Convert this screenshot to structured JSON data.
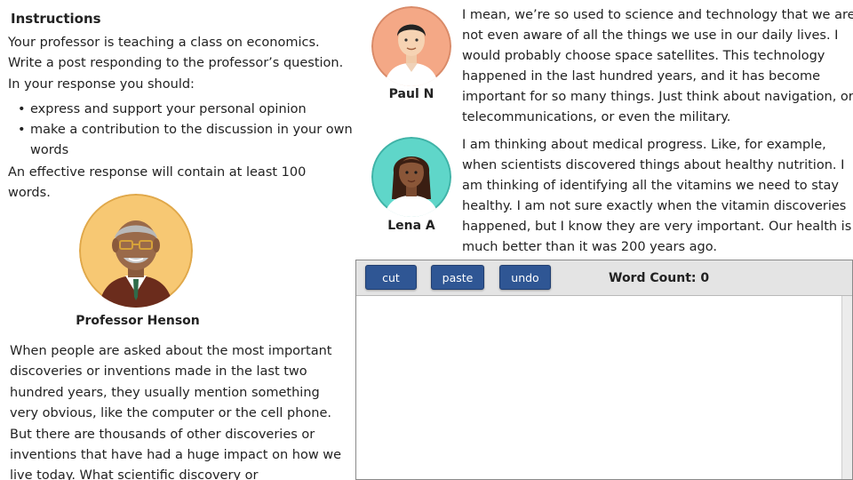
{
  "instructions": {
    "title": "Instructions",
    "lines": [
      "Your professor is teaching a class on economics.",
      "Write a post responding to the professor’s question.",
      "In your response you should:"
    ],
    "bullets": [
      "express and support your personal opinion",
      "make a contribution to the discussion in your own",
      "words"
    ],
    "effective": [
      "An effective response will contain at least 100",
      "words."
    ]
  },
  "professor": {
    "name": "Professor Henson",
    "text_lines": [
      "When people are asked about the most important",
      "discoveries or inventions made in the last two",
      "hundred years, they usually mention something",
      "very obvious, like the computer or the cell phone.",
      "But there are thousands of other discoveries or",
      "inventions that have had a huge impact on how we",
      "live today. What scientific discovery or"
    ]
  },
  "students": [
    {
      "name": "Paul N",
      "text_lines": [
        "I mean, we’re so used to science and technology that we are",
        "not even aware of all the things we use in our daily lives. I",
        "would probably choose space satellites. This technology",
        "happened in the last hundred years, and it has become",
        "important for so many things. Just think about navigation, or",
        "telecommunications, or even the military."
      ]
    },
    {
      "name": "Lena A",
      "text_lines": [
        "I am thinking about medical progress. Like, for example,",
        "when scientists discovered things about healthy nutrition. I",
        "am thinking of identifying all the vitamins we need to stay",
        "healthy. I am not sure exactly when the vitamin discoveries",
        "happened, but I know they are very important. Our health is",
        "much better than it was 200 years ago."
      ]
    }
  ],
  "editor": {
    "buttons": {
      "cut": "cut",
      "paste": "paste",
      "undo": "undo"
    },
    "word_count_label": "Word Count: 0",
    "content": ""
  },
  "colors": {
    "button_blue": "#2f5694",
    "toolbar_gray": "#e4e4e4",
    "professor_avatar_bg": "#f7c873",
    "paul_avatar_bg": "#f4a886",
    "lena_avatar_bg": "#5fd6c9"
  }
}
